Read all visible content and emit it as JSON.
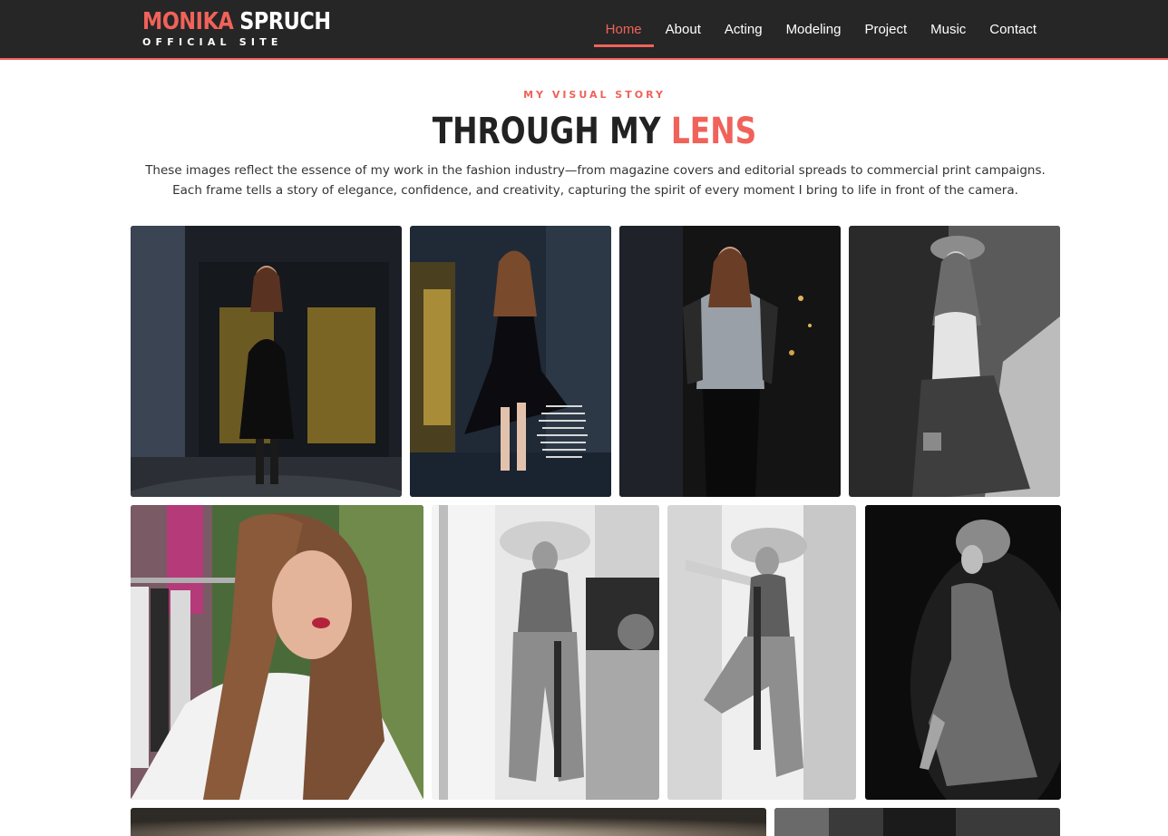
{
  "header": {
    "logo_first": "MONIKA",
    "logo_last": "SPRUCH",
    "logo_sub": "OFFICIAL SITE",
    "nav": [
      {
        "label": "Home",
        "active": true
      },
      {
        "label": "About"
      },
      {
        "label": "Acting"
      },
      {
        "label": "Modeling"
      },
      {
        "label": "Project"
      },
      {
        "label": "Music"
      },
      {
        "label": "Contact"
      }
    ]
  },
  "intro": {
    "eyebrow": "MY VISUAL STORY",
    "headline_main": "THROUGH MY",
    "headline_accent": "LENS",
    "line1": "These images reflect the essence of my work in the fashion industry—from magazine covers and editorial spreads to commercial print campaigns.",
    "line2": "Each frame tells a story of elegance, confidence, and creativity, capturing the spirit of every moment I bring to life in front of the camera."
  },
  "colors": {
    "accent": "#f0625a",
    "header_bg": "#262626",
    "heading": "#222222"
  }
}
